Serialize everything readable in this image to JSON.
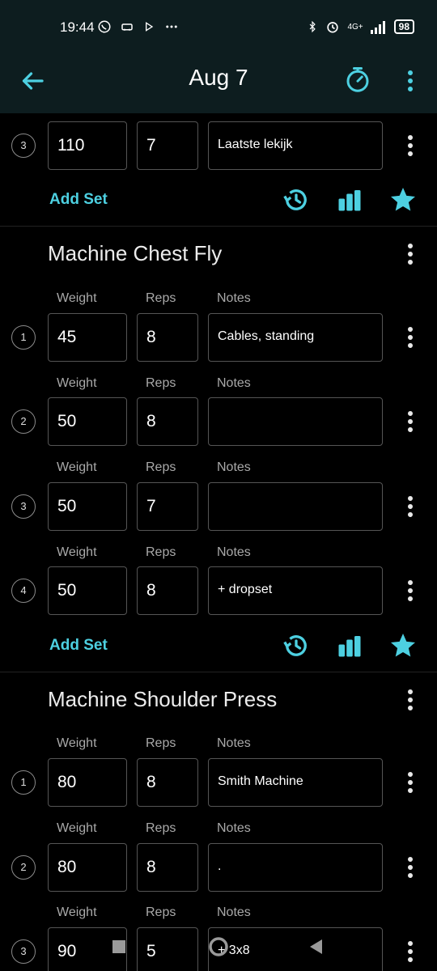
{
  "statusbar": {
    "time": "19:44",
    "left_icons": [
      "whatsapp-icon",
      "car-icon",
      "play-icon",
      "more-dots"
    ],
    "network": "4G+",
    "battery": "98"
  },
  "appbar": {
    "title": "Aug 7"
  },
  "labels": {
    "weight": "Weight",
    "reps": "Reps",
    "notes": "Notes"
  },
  "accent_color": "#4dd0e1",
  "previous_exercise": {
    "sets": [
      {
        "num": "3",
        "weight": "110",
        "reps": "7",
        "notes": "Laatste lekijk"
      }
    ],
    "add_set_label": "Add Set"
  },
  "exercises": [
    {
      "title": "Machine Chest Fly",
      "add_set_label": "Add Set",
      "sets": [
        {
          "num": "1",
          "weight": "45",
          "reps": "8",
          "notes": "Cables, standing"
        },
        {
          "num": "2",
          "weight": "50",
          "reps": "8",
          "notes": ""
        },
        {
          "num": "3",
          "weight": "50",
          "reps": "7",
          "notes": ""
        },
        {
          "num": "4",
          "weight": "50",
          "reps": "8",
          "notes": "+ dropset"
        }
      ]
    },
    {
      "title": "Machine Shoulder Press",
      "sets": [
        {
          "num": "1",
          "weight": "80",
          "reps": "8",
          "notes": "Smith Machine"
        },
        {
          "num": "2",
          "weight": "80",
          "reps": "8",
          "notes": "."
        },
        {
          "num": "3",
          "weight": "90",
          "reps": "5",
          "notes": "+ 3x8"
        }
      ]
    }
  ]
}
